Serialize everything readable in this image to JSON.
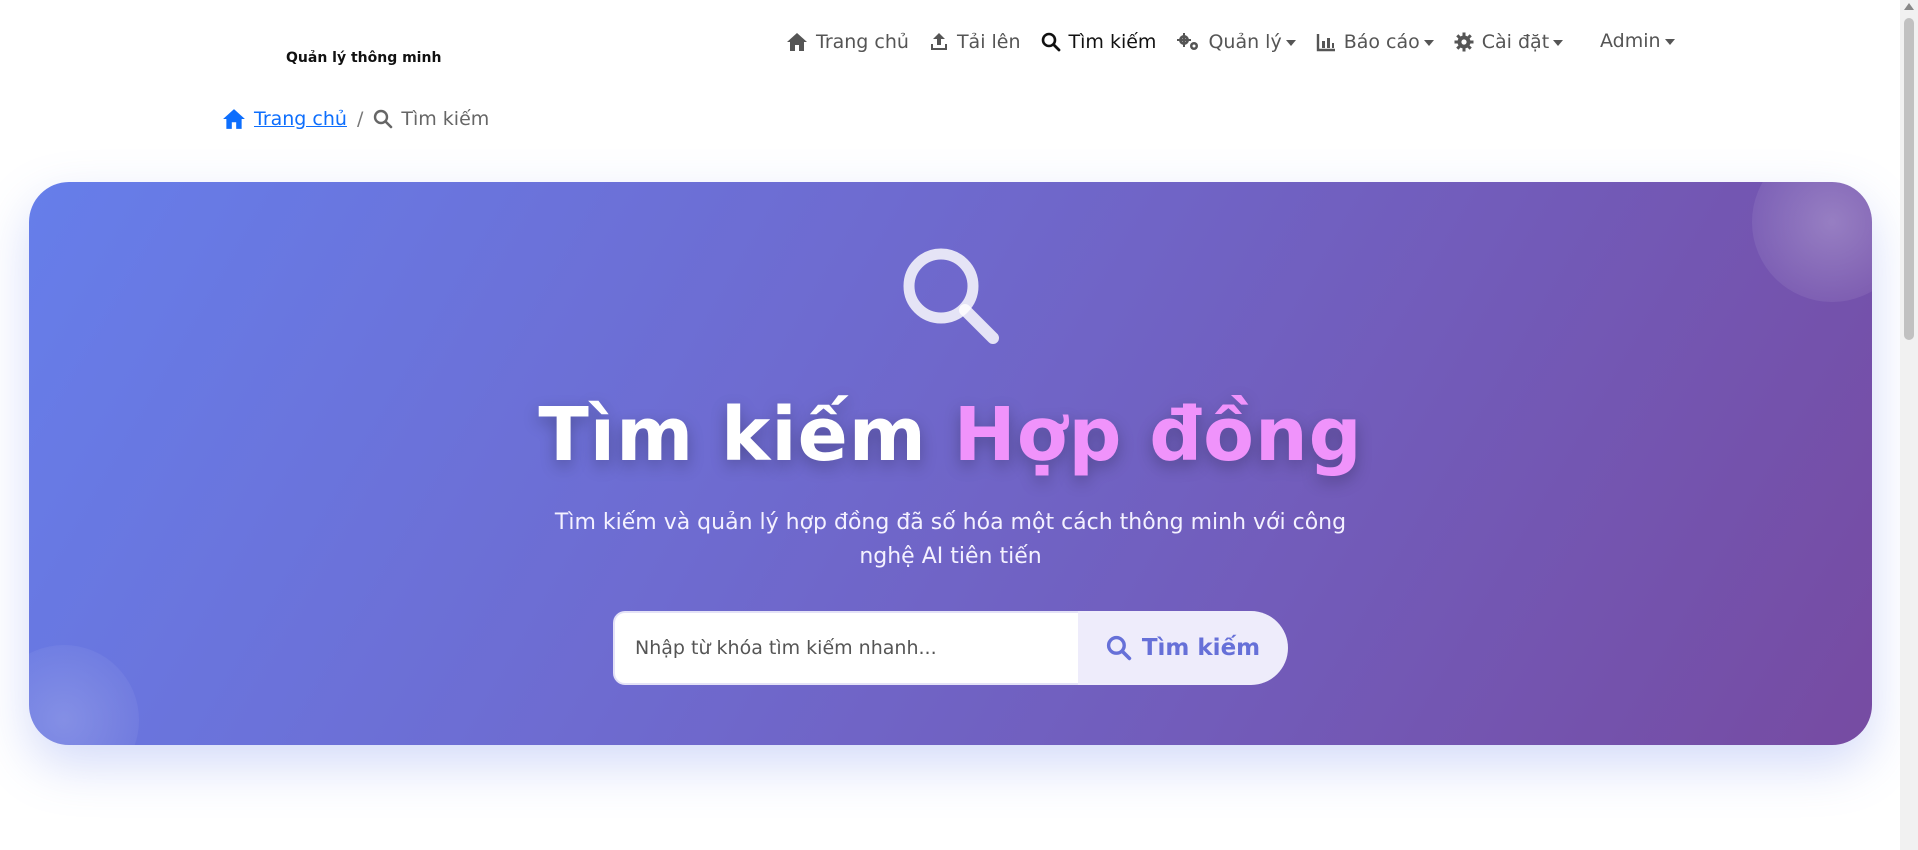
{
  "brand": {
    "title": "Quản lý thông minh"
  },
  "nav": {
    "items": [
      {
        "label": "Trang chủ",
        "icon": "home-icon"
      },
      {
        "label": "Tải lên",
        "icon": "upload-icon"
      },
      {
        "label": "Tìm kiếm",
        "icon": "search-icon",
        "active": true
      },
      {
        "label": "Quản lý",
        "icon": "cogs-icon",
        "dropdown": true
      },
      {
        "label": "Báo cáo",
        "icon": "chart-icon",
        "dropdown": true
      },
      {
        "label": "Cài đặt",
        "icon": "gear-icon",
        "dropdown": true
      }
    ],
    "user": "Admin"
  },
  "breadcrumb": {
    "home": "Trang chủ",
    "separator": "/",
    "current": "Tìm kiếm"
  },
  "hero": {
    "title_main": "Tìm kiếm",
    "title_accent": "Hợp đồng",
    "subtitle": "Tìm kiếm và quản lý hợp đồng đã số hóa một cách thông minh với công nghệ AI tiên tiến",
    "search_placeholder": "Nhập từ khóa tìm kiếm nhanh...",
    "search_value": "",
    "search_button": "Tìm kiếm"
  },
  "colors": {
    "gradient_start": "#667eea",
    "gradient_end": "#764ba2",
    "title_accent": "#f093fb",
    "link": "#0d6efd"
  }
}
